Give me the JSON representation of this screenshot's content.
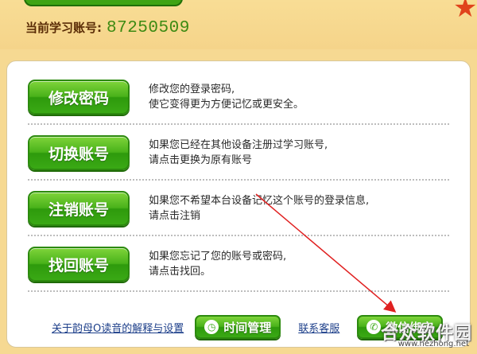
{
  "account": {
    "label": "当前学习账号:",
    "number": "87250509"
  },
  "options": [
    {
      "button": "修改密码",
      "lines": [
        "修改您的登录密码,",
        "使它变得更为方便记忆或更安全。"
      ]
    },
    {
      "button": "切换账号",
      "lines": [
        "如果您已经在其他设备注册过学习账号,",
        "请点击更换为原有账号"
      ]
    },
    {
      "button": "注销账号",
      "lines": [
        "如果您不希望本台设备记忆这个账号的登录信息,",
        "请点击注销"
      ]
    },
    {
      "button": "找回账号",
      "lines": [
        "如果您忘记了您的账号或密码,",
        "请点击找回。"
      ]
    }
  ],
  "footer": {
    "about_link": "关于韵母O读音的解释与设置",
    "time_button": "时间管理",
    "support_link": "联系客服",
    "wechat_button": "微信绑定"
  },
  "icons": {
    "time_icon": "clock-icon",
    "wechat_icon": "wechat-icon"
  },
  "colors": {
    "accent_green": "#3aa915",
    "background": "#f6d992",
    "link_blue": "#1d3f8a",
    "annotation_red": "#e02020"
  },
  "watermark": {
    "brand": "合众软件园",
    "url": "www.hezhong.net"
  }
}
